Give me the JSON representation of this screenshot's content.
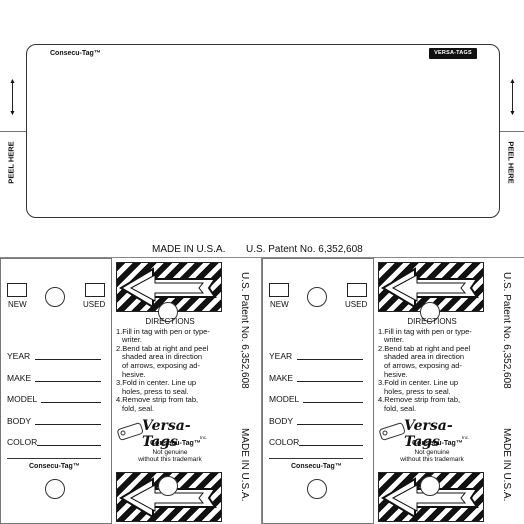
{
  "top": {
    "brand": "Consecu-Tag™",
    "badge": "VERSA-TAGS",
    "peel_left": "PEEL HERE",
    "peel_right": "PEEL HERE"
  },
  "footer": {
    "made_in": "MADE IN U.S.A.",
    "patent": "U.S. Patent No. 6,352,608"
  },
  "tags": [
    {
      "new_label": "NEW",
      "used_label": "USED",
      "fields": [
        "YEAR",
        "MAKE",
        "MODEL",
        "BODY",
        "COLOR"
      ],
      "brand": "Consecu-Tag™",
      "directions_title": "DIRECTIONS",
      "directions": [
        "1.Fill in tag with pen or type-",
        "writer.",
        "2.Bend tab at right and peel",
        "shaded area in direction",
        "of arrows, exposing ad-",
        "hesive.",
        "3.Fold in center. Line up",
        "holes, press to seal.",
        "4.Remove strip from tab,",
        "fold, seal."
      ],
      "logo": "Versa-Tags",
      "logo_inc": "Inc.",
      "logo_brand": "Consecu-Tag™",
      "not_genuine_1": "Not genuine",
      "not_genuine_2": "without this trademark",
      "side_patent": "U.S. Patent No. 6,352,608",
      "side_made": "MADE IN U.S.A."
    },
    {
      "new_label": "NEW",
      "used_label": "USED",
      "fields": [
        "YEAR",
        "MAKE",
        "MODEL",
        "BODY",
        "COLOR"
      ],
      "brand": "Consecu-Tag™",
      "directions_title": "DIRECTIONS",
      "directions": [
        "1.Fill in tag with pen or type-",
        "writer.",
        "2.Bend tab at right and peel",
        "shaded area in direction",
        "of arrows, exposing ad-",
        "hesive.",
        "3.Fold in center. Line up",
        "holes, press to seal.",
        "4.Remove strip from tab,",
        "fold, seal."
      ],
      "logo": "Versa-Tags",
      "logo_inc": "Inc.",
      "logo_brand": "Consecu-Tag™",
      "not_genuine_1": "Not genuine",
      "not_genuine_2": "without this trademark",
      "side_patent": "U.S. Patent No. 6,352,608",
      "side_made": "MADE IN U.S.A."
    }
  ]
}
